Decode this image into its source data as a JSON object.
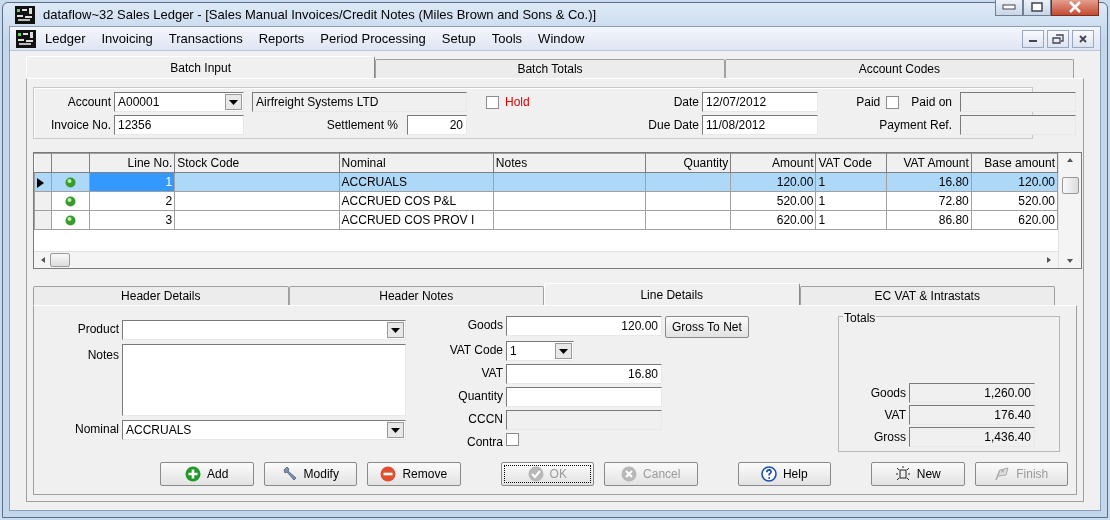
{
  "window": {
    "title": "dataflow~32 Sales Ledger - [Sales Manual Invoices/Credit Notes (Miles Brown and Sons & Co.)]"
  },
  "menu": [
    "Ledger",
    "Invoicing",
    "Transactions",
    "Reports",
    "Period Processing",
    "Setup",
    "Tools",
    "Window"
  ],
  "tabs": [
    {
      "label": "Batch Input",
      "selected": true
    },
    {
      "label": "Batch Totals",
      "selected": false
    },
    {
      "label": "Account Codes",
      "selected": false
    }
  ],
  "header": {
    "account_label": "Account",
    "account": "A00001",
    "account_name": "Airfreight Systems LTD",
    "hold": {
      "label": "Hold",
      "checked": false
    },
    "invoice_label": "Invoice No.",
    "invoice": "12356",
    "settlement_label": "Settlement %",
    "settlement": "20",
    "date_label": "Date",
    "date": "12/07/2012",
    "due_label": "Due Date",
    "due_date": "11/08/2012",
    "paid": {
      "label": "Paid",
      "checked": false
    },
    "paid_on_label": "Paid on",
    "payment_ref_label": "Payment Ref."
  },
  "table": {
    "columns": [
      "Line No.",
      "Stock Code",
      "Nominal",
      "Notes",
      "Quantity",
      "Amount",
      "VAT Code",
      "VAT Amount",
      "Base amount"
    ],
    "rows": [
      {
        "line": "1",
        "nominal": "ACCRUALS",
        "amount": "120.00",
        "vat_code": "1",
        "vat_amount": "16.80",
        "base_amount": "120.00",
        "selected": true
      },
      {
        "line": "2",
        "nominal": "ACCRUED COS P&L",
        "amount": "520.00",
        "vat_code": "1",
        "vat_amount": "72.80",
        "base_amount": "520.00",
        "selected": false
      },
      {
        "line": "3",
        "nominal": "ACCRUED COS PROV I",
        "amount": "620.00",
        "vat_code": "1",
        "vat_amount": "86.80",
        "base_amount": "620.00",
        "selected": false
      }
    ]
  },
  "detail_tabs": [
    {
      "label": "Header Details",
      "selected": false
    },
    {
      "label": "Header Notes",
      "selected": false
    },
    {
      "label": "Line Details",
      "selected": true
    },
    {
      "label": "EC VAT & Intrastats",
      "selected": false
    }
  ],
  "line_details": {
    "product_label": "Product",
    "notes_label": "Notes",
    "nominal_label": "Nominal",
    "nominal": "ACCRUALS",
    "goods_label": "Goods",
    "goods": "120.00",
    "gross_to_net": "Gross To Net",
    "vat_code_label": "VAT Code",
    "vat_code": "1",
    "vat_label": "VAT",
    "vat": "16.80",
    "quantity_label": "Quantity",
    "cccn_label": "CCCN",
    "contra": {
      "label": "Contra",
      "checked": false
    }
  },
  "totals": {
    "title": "Totals",
    "items": [
      {
        "label": "Goods",
        "value": "1,260.00"
      },
      {
        "label": "VAT",
        "value": "176.40"
      },
      {
        "label": "Gross",
        "value": "1,436.40"
      }
    ]
  },
  "buttons": [
    {
      "label": "Add",
      "kind": "add",
      "disabled": false
    },
    {
      "label": "Modify",
      "kind": "modify",
      "disabled": false
    },
    {
      "label": "Remove",
      "kind": "remove",
      "disabled": false
    },
    {
      "label": "OK",
      "kind": "ok",
      "disabled": true
    },
    {
      "label": "Cancel",
      "kind": "cancel",
      "disabled": true
    },
    {
      "label": "Help",
      "kind": "help",
      "disabled": false
    },
    {
      "label": "New",
      "kind": "new",
      "disabled": false
    },
    {
      "label": "Finish",
      "kind": "finish",
      "disabled": true
    }
  ]
}
